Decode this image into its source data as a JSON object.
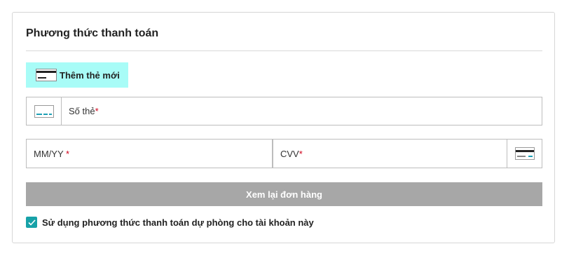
{
  "payment": {
    "title": "Phương thức thanh toán",
    "add_card_label": "Thêm thẻ mới",
    "card_number_placeholder": "Số thẻ",
    "expiry_placeholder": "MM/YY ",
    "cvv_placeholder": "CVV",
    "required_mark": "*",
    "review_button_label": "Xem lại đơn hàng",
    "backup_checkbox_label": "Sử dụng phương thức thanh toán dự phòng cho tài khoản này",
    "backup_checkbox_checked": true,
    "icons": {
      "add_card": "credit-card-icon",
      "card_number": "credit-card-icon",
      "cvv": "credit-card-back-icon",
      "checkbox": "checkmark-icon"
    },
    "colors": {
      "tab_active_bg": "#a8fcf7",
      "button_disabled_bg": "#a7a7a7",
      "checkbox_bg": "#17a2a8",
      "required": "#d0021b"
    }
  }
}
